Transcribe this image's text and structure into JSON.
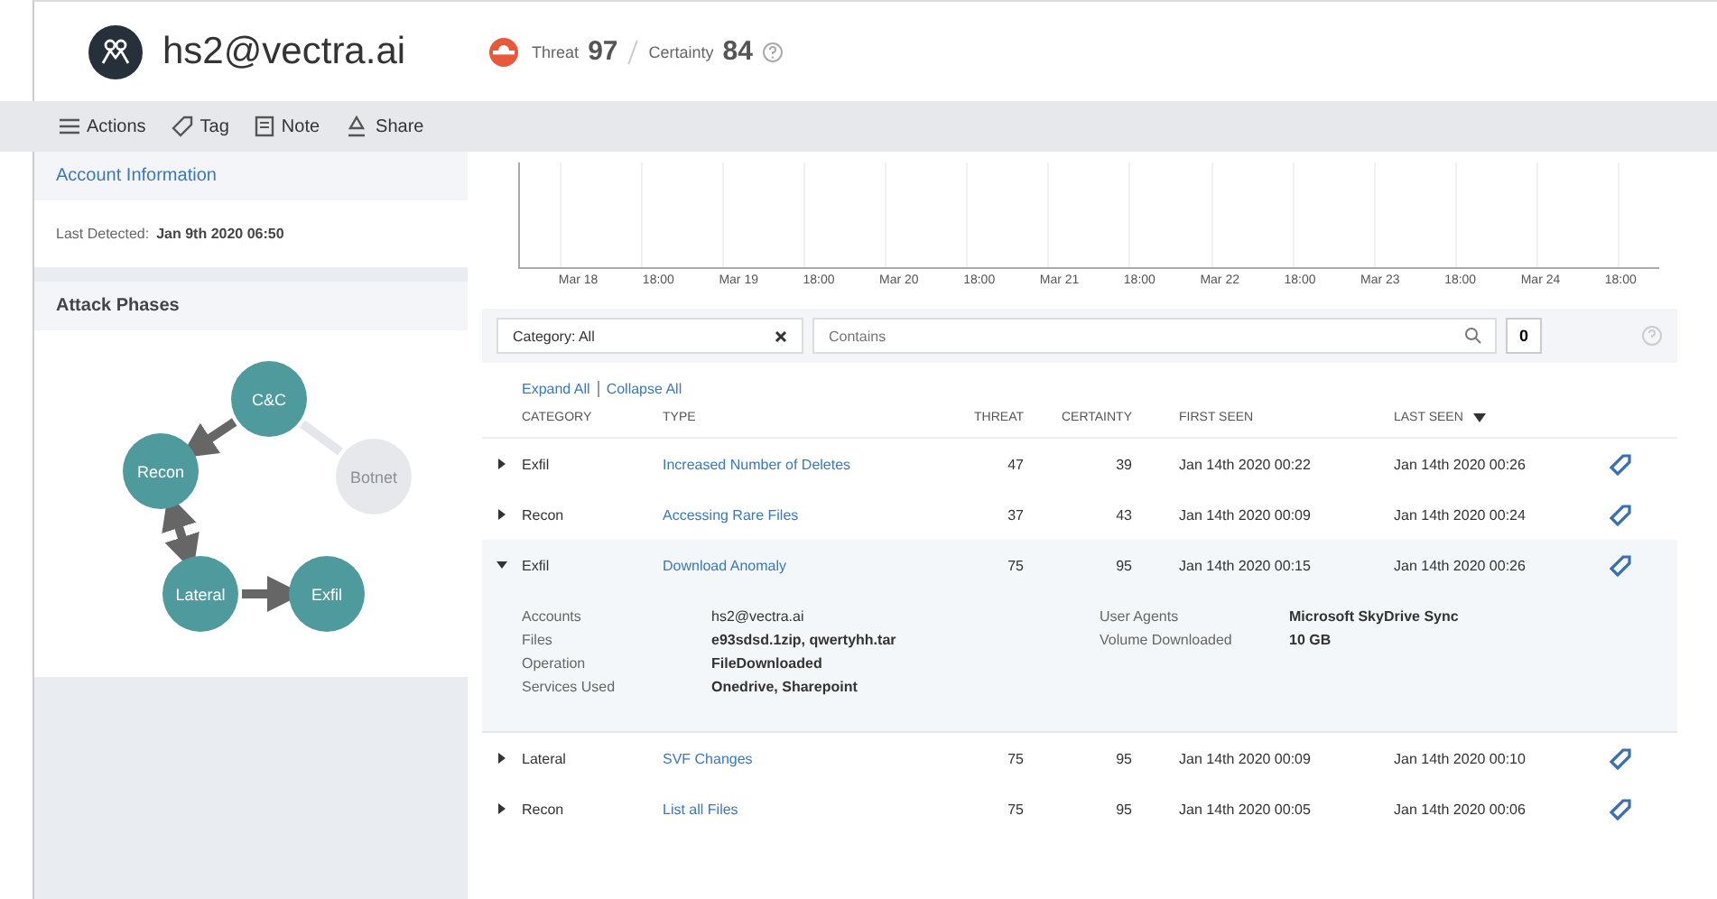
{
  "header": {
    "account": "hs2@vectra.ai",
    "threat_label": "Threat",
    "threat": "97",
    "certainty_label": "Certainty",
    "certainty": "84"
  },
  "toolbar": [
    {
      "kind": "menu",
      "label": "Actions"
    },
    {
      "kind": "tag",
      "label": "Tag"
    },
    {
      "kind": "note",
      "label": "Note"
    },
    {
      "kind": "share",
      "label": "Share"
    }
  ],
  "sidebar": {
    "account_info": {
      "title": "Account Information",
      "last_detected_label": "Last Detected:",
      "last_detected": "Jan 9th 2020 06:50"
    },
    "attack_phases": {
      "title": "Attack Phases",
      "nodes": [
        {
          "label": "C&C",
          "active": true
        },
        {
          "label": "Recon",
          "active": true
        },
        {
          "label": "Botnet",
          "active": false
        },
        {
          "label": "Lateral",
          "active": true
        },
        {
          "label": "Exfil",
          "active": true
        }
      ]
    }
  },
  "timeline": {
    "x_labels": [
      "Mar 18",
      "18:00",
      "Mar 19",
      "18:00",
      "Mar 20",
      "18:00",
      "Mar 21",
      "18:00",
      "Mar 22",
      "18:00",
      "Mar 23",
      "18:00",
      "Mar 24",
      "18:00"
    ]
  },
  "filters": {
    "category": "Category: All",
    "search_placeholder": "Contains",
    "count": "0"
  },
  "table": {
    "expand_all": "Expand All",
    "collapse_all": "Collapse All",
    "columns": [
      "CATEGORY",
      "TYPE",
      "THREAT",
      "CERTAINTY",
      "FIRST SEEN",
      "LAST SEEN"
    ],
    "rows": [
      {
        "category": "Exfil",
        "type": "Increased Number of Deletes",
        "threat": "47",
        "certainty": "39",
        "first_seen": "Jan 14th 2020 00:22",
        "last_seen": "Jan 14th 2020 00:26",
        "expanded": false
      },
      {
        "category": "Recon",
        "type": "Accessing Rare Files",
        "threat": "37",
        "certainty": "43",
        "first_seen": "Jan 14th 2020 00:09",
        "last_seen": "Jan 14th 2020 00:24",
        "expanded": false
      },
      {
        "category": "Exfil",
        "type": "Download Anomaly",
        "threat": "75",
        "certainty": "95",
        "first_seen": "Jan 14th 2020 00:15",
        "last_seen": "Jan 14th 2020 00:26",
        "expanded": true,
        "details_left": [
          {
            "label": "Accounts",
            "value": "hs2@vectra.ai",
            "kind": "link"
          },
          {
            "label": "Files",
            "value": "e93sdsd.1zip, qwertyhh.tar",
            "kind": "text"
          },
          {
            "label": "Operation",
            "value": "FileDownloaded",
            "kind": "text"
          },
          {
            "label": "Services Used",
            "value": "Onedrive, Sharepoint",
            "kind": "text"
          }
        ],
        "details_right": [
          {
            "label": "User Agents",
            "value": "Microsoft SkyDrive Sync"
          },
          {
            "label": "Volume Downloaded",
            "value": "10 GB"
          }
        ]
      },
      {
        "category": "Lateral",
        "type": "SVF Changes",
        "threat": "75",
        "certainty": "95",
        "first_seen": "Jan 14th 2020 00:09",
        "last_seen": "Jan 14th 2020 00:10",
        "expanded": false
      },
      {
        "category": "Recon",
        "type": "List all Files",
        "threat": "75",
        "certainty": "95",
        "first_seen": "Jan 14th 2020 00:05",
        "last_seen": "Jan 14th 2020 00:06",
        "expanded": false
      }
    ]
  }
}
